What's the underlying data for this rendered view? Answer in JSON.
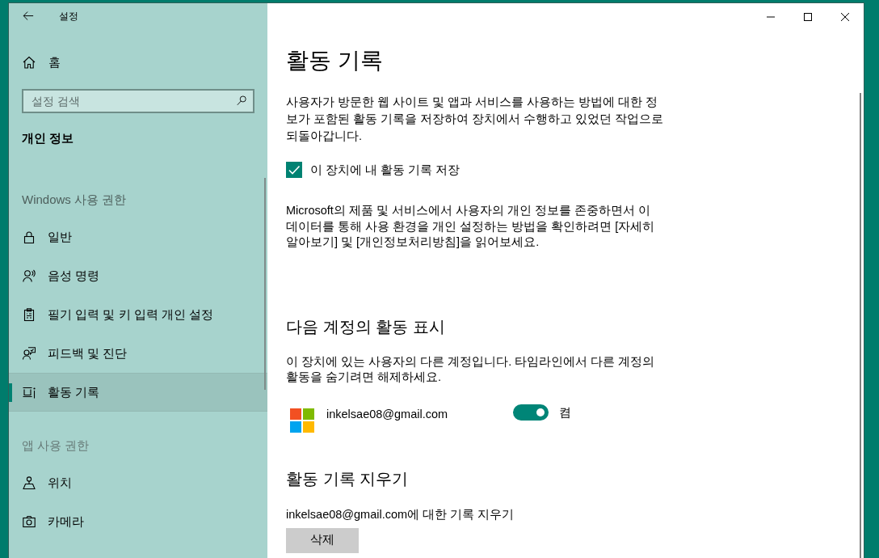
{
  "window": {
    "title": "설정"
  },
  "sidebar": {
    "home": "홈",
    "search": {
      "placeholder": "설정 검색"
    },
    "section_title": "개인 정보",
    "groups": [
      {
        "heading": "Windows 사용 권한",
        "items": [
          {
            "label": "일반",
            "selected": false
          },
          {
            "label": "음성 명령",
            "selected": false
          },
          {
            "label": "필기 입력 및 키 입력 개인 설정",
            "selected": false
          },
          {
            "label": "피드백 및 진단",
            "selected": false
          },
          {
            "label": "활동 기록",
            "selected": true
          }
        ]
      },
      {
        "heading": "앱 사용 권한",
        "items": [
          {
            "label": "위치",
            "selected": false
          },
          {
            "label": "카메라",
            "selected": false
          }
        ]
      }
    ]
  },
  "content": {
    "title": "활동 기록",
    "description": "사용자가 방문한 웹 사이트 및 앱과 서비스를 사용하는 방법에 대한 정보가 포함된 활동 기록을 저장하여 장치에서 수행하고 있었던 작업으로 되돌아갑니다.",
    "store_activity": {
      "label": "이 장치에 내 활동 기록 저장",
      "checked": true
    },
    "privacy_note": "Microsoft의 제품 및 서비스에서 사용자의 개인 정보를 존중하면서 이 데이터를 통해 사용 환경을 개인 설정하는 방법을 확인하려면 [자세히 알아보기] 및 [개인정보처리방침]을 읽어보세요.",
    "show_activities": {
      "heading": "다음 계정의 활동 표시",
      "description": "이 장치에 있는 사용자의 다른 계정입니다. 타임라인에서 다른 계정의 활동을 숨기려면 해제하세요.",
      "accounts": [
        {
          "email": "inkelsae08@gmail.com",
          "on": true,
          "state_label": "켬"
        }
      ]
    },
    "clear_history": {
      "heading": "활동 기록 지우기",
      "label": "inkelsae08@gmail.com에 대한 기록 지우기",
      "button": "삭제"
    }
  }
}
